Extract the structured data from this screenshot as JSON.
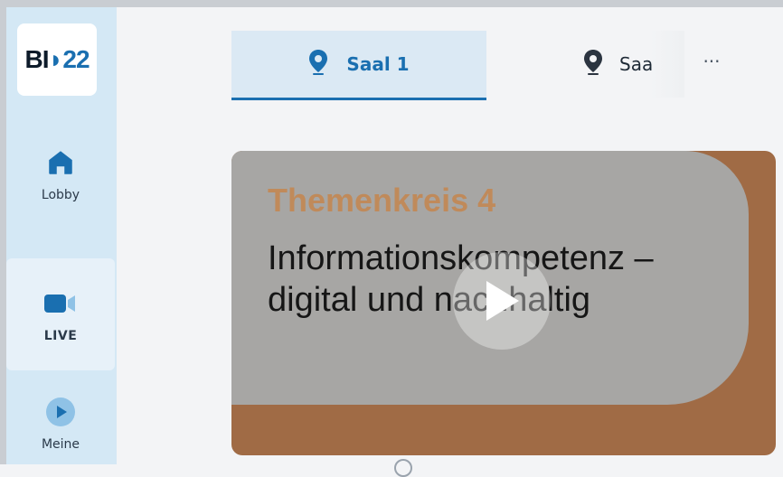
{
  "app": {
    "logo": {
      "part1": "BI",
      "part2": "◗22"
    },
    "colors": {
      "accent": "#1a6fb0",
      "sidebar_bg": "#d4e8f5",
      "video_brown": "#a06b45",
      "slide_grey": "#a7a6a4",
      "kicker": "#c08a5a"
    }
  },
  "sidebar": {
    "items": [
      {
        "label": "Lobby",
        "icon": "home-icon"
      },
      {
        "label": "LIVE",
        "icon": "video-camera-icon",
        "active": true
      },
      {
        "label": "Meine",
        "icon": "play-circle-icon"
      }
    ]
  },
  "tabs": [
    {
      "label": "Saal 1",
      "icon": "location-pin-icon",
      "active": true
    },
    {
      "label": "Saa",
      "icon": "location-pin-icon",
      "active": false
    }
  ],
  "more_label": "···",
  "video": {
    "kicker": "Themenkreis 4",
    "title": "Informationskompetenz – digital und nachhaltig",
    "play_icon": "play-icon"
  }
}
